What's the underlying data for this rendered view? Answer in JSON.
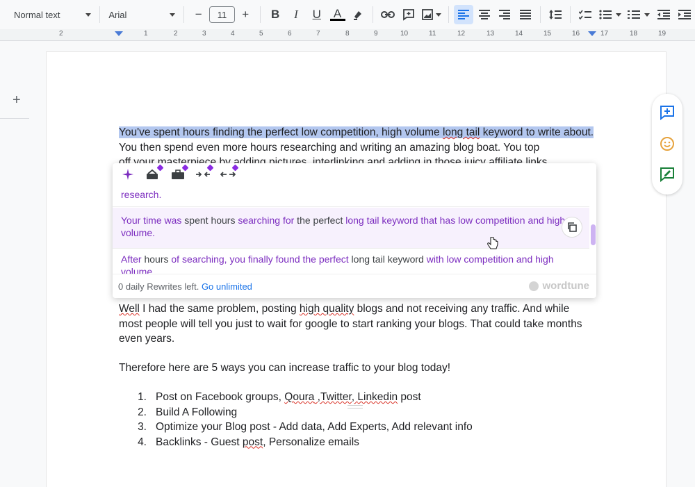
{
  "toolbar": {
    "style_select": "Normal text",
    "font_select": "Arial",
    "font_size": "11",
    "decrease": "−",
    "increase": "+",
    "bold": "B",
    "italic": "I",
    "underline": "U",
    "text_color": "A"
  },
  "ruler": {
    "labels": [
      "2",
      "1",
      "1",
      "2",
      "3",
      "4",
      "5",
      "6",
      "7",
      "8",
      "9",
      "10",
      "11",
      "12",
      "13",
      "14",
      "15",
      "16",
      "17",
      "18",
      "19"
    ]
  },
  "left_margin": {
    "plus": "+"
  },
  "document": {
    "para1_highlighted_a": "You've spent hours finding the perfect low competition, high volume ",
    "para1_highlighted_b": "long tail",
    "para1_highlighted_c": " keyword to write about.",
    "para1_rest": " You then spend even more hours researching and writing an amazing blog boat. You top",
    "para1_line3": "off your masterpiece by adding pictures, interlinking and adding in those juicy affiliate links",
    "para2_a": "Well",
    "para2_b": " I had the same problem, posting ",
    "para2_c": "high quality",
    "para2_d": " blogs and not receiving any traffic. And while most people will tell you just to wait for google to start ranking your blogs. That could take months even years.",
    "para3": "Therefore here are 5 ways you can increase traffic to your blog today!",
    "list": [
      {
        "num": "1.",
        "parts": [
          "Post on Facebook groups, ",
          "Qoura",
          " ,Twitter, ",
          "Linkedin",
          " post"
        ]
      },
      {
        "num": "2.",
        "text": "Build A Following"
      },
      {
        "num": "3.",
        "text": "Optimize your Blog post - Add data, Add Experts, Add relevant info"
      },
      {
        "num": "4.",
        "parts": [
          "Backlinks - Guest ",
          "post",
          ", Personalize emails"
        ]
      }
    ]
  },
  "wordtune": {
    "option0_tail": "research.",
    "option1": {
      "p1": "Your time was",
      "p2": " spent hours ",
      "p3": "searching for",
      "p4": " the perfect ",
      "p5": "long tail keyword that has low competition and high volume."
    },
    "option2": {
      "p1": "After",
      "p2": " hours ",
      "p3": "of searching, you finally found the perfect",
      "p4": " long tail keyword ",
      "p5": "with low competition and high volume"
    },
    "footer_left": "0 daily Rewrites left. ",
    "footer_link": "Go unlimited",
    "brand": "wordtune",
    "accent": "#7b2cbf"
  },
  "colors": {
    "highlight": "#b3c7ef",
    "link": "#1a73e8",
    "spell": "#d93025"
  }
}
